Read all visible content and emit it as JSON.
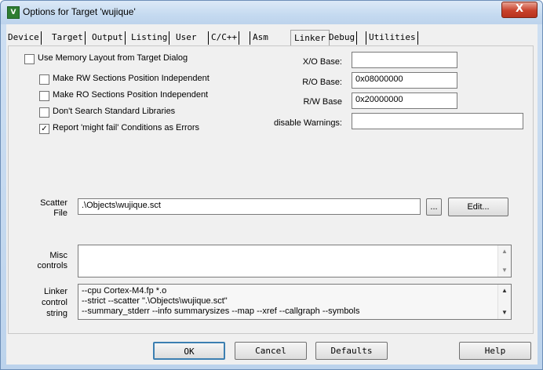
{
  "window": {
    "title": "Options for Target 'wujique'",
    "icon": "uvision-icon",
    "close_glyph": "X"
  },
  "tabs": [
    {
      "label": "Device",
      "active": false
    },
    {
      "label": "Target",
      "active": false
    },
    {
      "label": "Output",
      "active": false
    },
    {
      "label": "Listing",
      "active": false
    },
    {
      "label": "User",
      "active": false
    },
    {
      "label": "C/C++",
      "active": false
    },
    {
      "label": "Asm",
      "active": false
    },
    {
      "label": "Linker",
      "active": true
    },
    {
      "label": "Debug",
      "active": false
    },
    {
      "label": "Utilities",
      "active": false
    }
  ],
  "linker": {
    "use_memory_layout": {
      "label": "Use Memory Layout from Target Dialog",
      "checked": false
    },
    "rw_independent": {
      "label": "Make RW Sections Position Independent",
      "checked": false
    },
    "ro_independent": {
      "label": "Make RO Sections Position Independent",
      "checked": false
    },
    "no_std_libs": {
      "label": "Don't Search Standard Libraries",
      "checked": false
    },
    "might_fail": {
      "label": "Report 'might fail' Conditions as Errors",
      "checked": true,
      "mark": "✓"
    },
    "xo_base": {
      "label": "X/O Base:",
      "value": ""
    },
    "ro_base": {
      "label": "R/O Base:",
      "value": "0x08000000"
    },
    "rw_base": {
      "label": "R/W Base",
      "value": "0x20000000"
    },
    "disable_warnings": {
      "label": "disable Warnings:",
      "value": ""
    },
    "scatter": {
      "label_line1": "Scatter",
      "label_line2": "File",
      "value": ".\\Objects\\wujique.sct",
      "browse_label": "...",
      "edit_label": "Edit..."
    },
    "misc": {
      "label_line1": "Misc",
      "label_line2": "controls",
      "value": ""
    },
    "control_string": {
      "label_line1": "Linker",
      "label_line2": "control",
      "label_line3": "string",
      "lines": [
        "--cpu Cortex-M4.fp *.o",
        "--strict --scatter \".\\Objects\\wujique.sct\"",
        "--summary_stderr --info summarysizes --map --xref --callgraph --symbols"
      ]
    }
  },
  "buttons": {
    "ok": "OK",
    "cancel": "Cancel",
    "defaults": "Defaults",
    "help": "Help"
  },
  "scroll_glyphs": {
    "up": "▲",
    "down": "▼"
  }
}
